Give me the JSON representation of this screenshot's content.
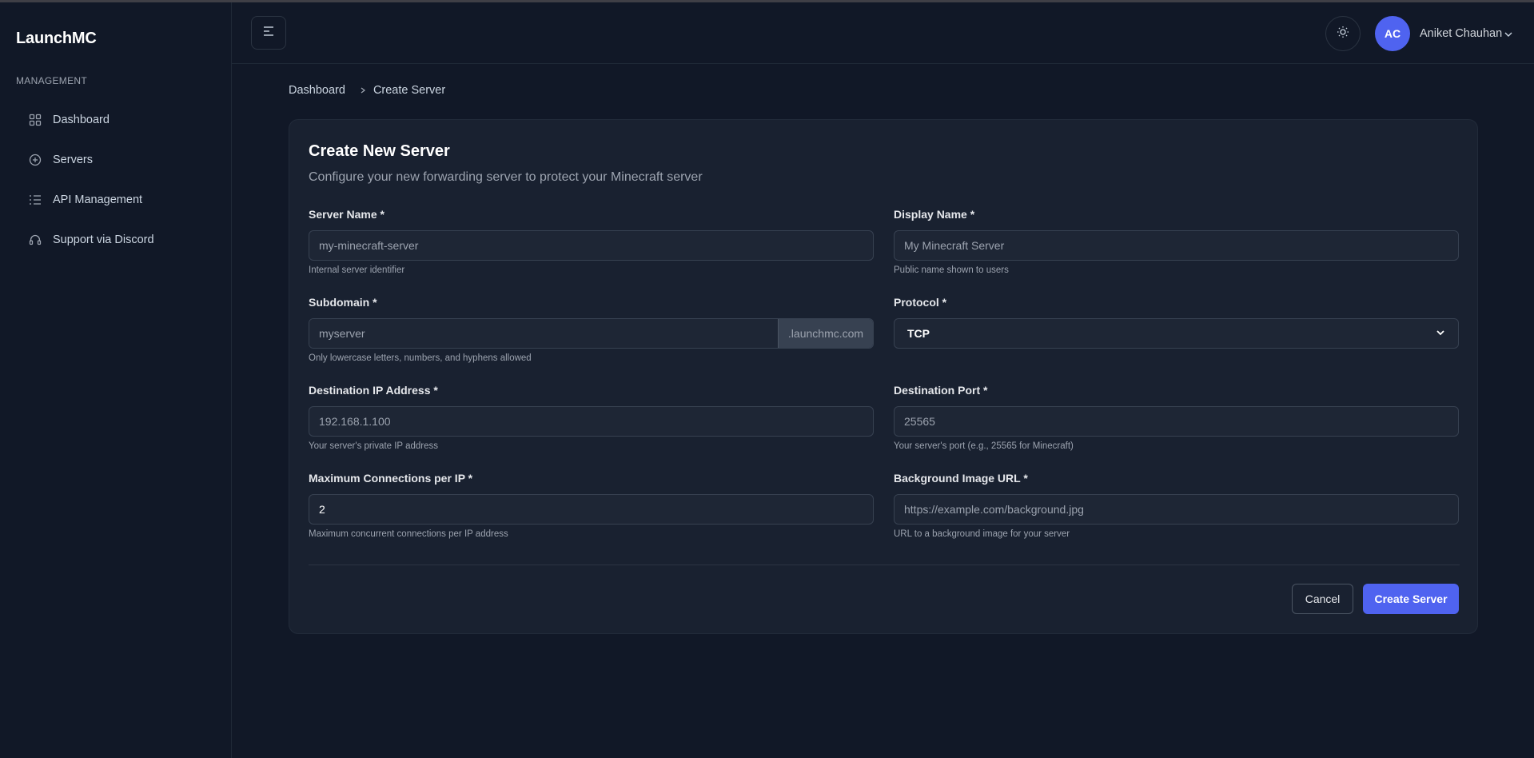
{
  "app": {
    "brand": "LaunchMC"
  },
  "sidebar": {
    "section_label": "MANAGEMENT",
    "items": [
      {
        "label": "Dashboard",
        "icon": "grid-icon"
      },
      {
        "label": "Servers",
        "icon": "plus-circle-icon"
      },
      {
        "label": "API Management",
        "icon": "list-settings-icon"
      },
      {
        "label": "Support via Discord",
        "icon": "headset-icon"
      }
    ]
  },
  "header": {
    "menu_icon": "menu-icon",
    "theme_icon": "sun-icon",
    "user": {
      "initials": "AC",
      "name": "Aniket Chauhan"
    },
    "avatar_color": "#4f63f0"
  },
  "breadcrumb": {
    "parent": "Dashboard",
    "current": "Create Server"
  },
  "form": {
    "title": "Create New Server",
    "subtitle": "Configure your new forwarding server to protect your Minecraft server",
    "server_name": {
      "label": "Server Name *",
      "placeholder": "my-minecraft-server",
      "help": "Internal server identifier"
    },
    "display_name": {
      "label": "Display Name *",
      "placeholder": "My Minecraft Server",
      "help": "Public name shown to users"
    },
    "subdomain": {
      "label": "Subdomain *",
      "placeholder": "myserver",
      "suffix": ".launchmc.com",
      "help": "Only lowercase letters, numbers, and hyphens allowed"
    },
    "protocol": {
      "label": "Protocol *",
      "value": "TCP"
    },
    "dest_ip": {
      "label": "Destination IP Address *",
      "placeholder": "192.168.1.100",
      "help": "Your server's private IP address"
    },
    "dest_port": {
      "label": "Destination Port *",
      "placeholder": "25565",
      "help": "Your server's port (e.g., 25565 for Minecraft)"
    },
    "max_conn": {
      "label": "Maximum Connections per IP *",
      "value": "2",
      "help": "Maximum concurrent connections per IP address"
    },
    "bg_url": {
      "label": "Background Image URL *",
      "placeholder": "https://example.com/background.jpg",
      "help": "URL to a background image for your server"
    },
    "cancel_label": "Cancel",
    "submit_label": "Create Server"
  },
  "colors": {
    "accent": "#4f63f0",
    "background": "#111827",
    "card": "#192130"
  }
}
